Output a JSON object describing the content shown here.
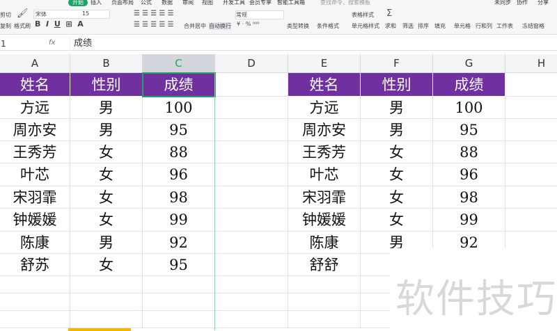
{
  "menu": [
    "开始",
    "插入",
    "页面布局",
    "公式",
    "数据",
    "审阅",
    "视图",
    "开发工具",
    "会员专享",
    "智能工具箱"
  ],
  "search_placeholder": "查找命令、搜索模板",
  "top_right": [
    "未同步",
    "协作",
    "分享"
  ],
  "ribbon": {
    "cut": "剪切",
    "copy": "复制",
    "format_painter": "格式刷",
    "font": "宋体",
    "size": "15",
    "merge": "合并居中",
    "wrap": "自动换行",
    "number_format": "常规",
    "convert": "类型转换",
    "cond_format": "条件格式",
    "table_style": "表格样式",
    "cell_style": "单元格样式",
    "sum": "求和",
    "filter": "筛选",
    "sort": "排序",
    "fill": "填充",
    "cell": "单元格",
    "rowcol": "行和列",
    "sheet": "工作表",
    "freeze": "冻结窗格"
  },
  "formula_bar": {
    "name_box": "1",
    "fx": "fx",
    "value": "成绩"
  },
  "columns": [
    "A",
    "B",
    "C",
    "D",
    "E",
    "F",
    "G",
    "H"
  ],
  "table1": {
    "headers": [
      "姓名",
      "性别",
      "成绩"
    ],
    "rows": [
      [
        "方远",
        "男",
        "100"
      ],
      [
        "周亦安",
        "男",
        "95"
      ],
      [
        "王秀芳",
        "女",
        "88"
      ],
      [
        "叶芯",
        "女",
        "96"
      ],
      [
        "宋羽霏",
        "女",
        "98"
      ],
      [
        "钟媛媛",
        "女",
        "99"
      ],
      [
        "陈康",
        "男",
        "92"
      ],
      [
        "舒苏",
        "女",
        "95"
      ]
    ]
  },
  "table2": {
    "headers": [
      "姓名",
      "性别",
      "成绩"
    ],
    "rows": [
      [
        "方远",
        "男",
        "100"
      ],
      [
        "周亦安",
        "男",
        "95"
      ],
      [
        "王秀芳",
        "女",
        "88"
      ],
      [
        "叶芯",
        "女",
        "96"
      ],
      [
        "宋羽霏",
        "女",
        "98"
      ],
      [
        "钟媛媛",
        "女",
        "99"
      ],
      [
        "陈康",
        "男",
        "92"
      ],
      [
        "舒舒",
        "",
        ""
      ]
    ]
  },
  "watermark": "软件技巧",
  "colors": {
    "header": "#7030a0",
    "accent": "#1fa463"
  }
}
